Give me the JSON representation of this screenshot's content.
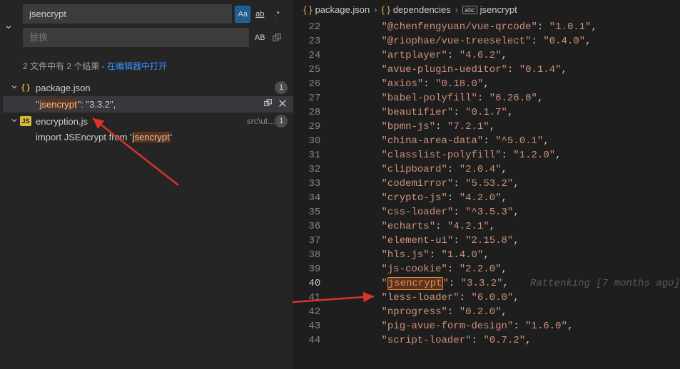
{
  "search": {
    "query": "jsencrypt",
    "replace_placeholder": "替换",
    "options": {
      "matchCase": "Aa",
      "wholeWord": "ab",
      "regex": ".*",
      "preserveCase": "AB"
    }
  },
  "summary": {
    "prefix": "2 文件中有 2 个结果 - ",
    "openLink": "在编辑器中打开"
  },
  "results": [
    {
      "file": "package.json",
      "iconType": "braces",
      "badge": "1",
      "matches": [
        {
          "before": "\"",
          "hl": "jsencrypt",
          "after": "\": \"3.3.2\","
        }
      ]
    },
    {
      "file": "encryption.js",
      "path": "src\\ut...",
      "iconType": "js",
      "badge": "1",
      "matches": [
        {
          "before": "import JSEncrypt from '",
          "hl": "jsencrypt",
          "after": "'"
        }
      ]
    }
  ],
  "breadcrumb": {
    "items": [
      {
        "icon": "braces",
        "label": "package.json"
      },
      {
        "icon": "braces",
        "label": "dependencies"
      },
      {
        "icon": "abc",
        "label": "jsencrypt"
      }
    ]
  },
  "editor": {
    "currentLine": 40,
    "blame": "Rattenking [7 months ago]",
    "lines": [
      {
        "n": 22,
        "key": "@chenfengyuan/vue-qrcode",
        "val": "1.0.1"
      },
      {
        "n": 23,
        "key": "@riophae/vue-treeselect",
        "val": "0.4.0"
      },
      {
        "n": 24,
        "key": "artplayer",
        "val": "4.6.2"
      },
      {
        "n": 25,
        "key": "avue-plugin-ueditor",
        "val": "0.1.4"
      },
      {
        "n": 26,
        "key": "axios",
        "val": "0.18.0"
      },
      {
        "n": 27,
        "key": "babel-polyfill",
        "val": "6.26.0"
      },
      {
        "n": 28,
        "key": "beautifier",
        "val": "0.1.7"
      },
      {
        "n": 29,
        "key": "bpmn-js",
        "val": "7.2.1"
      },
      {
        "n": 30,
        "key": "china-area-data",
        "val": "^5.0.1"
      },
      {
        "n": 31,
        "key": "classlist-polyfill",
        "val": "1.2.0"
      },
      {
        "n": 32,
        "key": "clipboard",
        "val": "2.0.4"
      },
      {
        "n": 33,
        "key": "codemirror",
        "val": "5.53.2"
      },
      {
        "n": 34,
        "key": "crypto-js",
        "val": "4.2.0"
      },
      {
        "n": 35,
        "key": "css-loader",
        "val": "^3.5.3"
      },
      {
        "n": 36,
        "key": "echarts",
        "val": "4.2.1"
      },
      {
        "n": 37,
        "key": "element-ui",
        "val": "2.15.8"
      },
      {
        "n": 38,
        "key": "hls.js",
        "val": "1.4.0"
      },
      {
        "n": 39,
        "key": "js-cookie",
        "val": "2.2.0"
      },
      {
        "n": 40,
        "key": "jsencrypt",
        "val": "3.3.2",
        "hl": true,
        "blame": true
      },
      {
        "n": 41,
        "key": "less-loader",
        "val": "6.0.0"
      },
      {
        "n": 42,
        "key": "nprogress",
        "val": "0.2.0"
      },
      {
        "n": 43,
        "key": "pig-avue-form-design",
        "val": "1.6.0"
      },
      {
        "n": 44,
        "key": "script-loader",
        "val": "0.7.2"
      }
    ]
  }
}
